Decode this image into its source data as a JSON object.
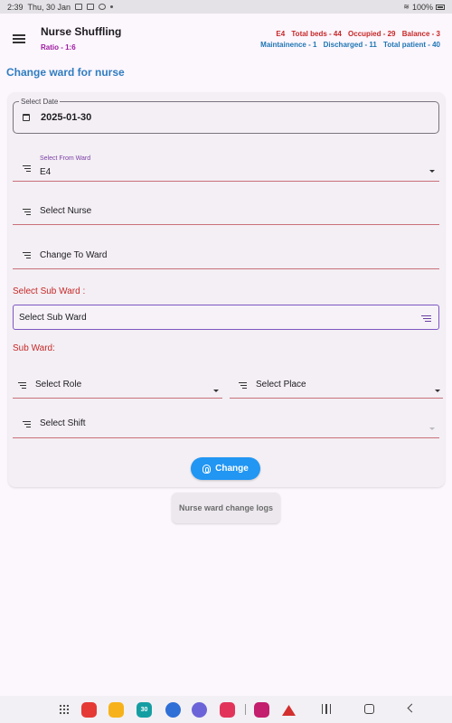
{
  "status_bar": {
    "time": "2:39",
    "date": "Thu, 30 Jan",
    "battery": "100%"
  },
  "header": {
    "title": "Nurse Shuffling",
    "ratio": "Ratio - 1:6",
    "stats_row1": [
      "E4",
      "Total beds - 44",
      "Occupied - 29",
      "Balance - 3"
    ],
    "stats_row2": [
      "Maintainence - 1",
      "Discharged - 11",
      "Total patient - 40"
    ],
    "colors": {
      "row1": "#c62828",
      "row2": "#1e76b4",
      "ratio": "#9c1aa0"
    }
  },
  "page": {
    "section_title": "Change ward for nurse"
  },
  "form": {
    "date_label": "Select Date",
    "date_value": "2025-01-30",
    "from_ward_label": "Select From Ward",
    "from_ward_value": "E4",
    "nurse_placeholder": "Select Nurse",
    "to_ward_placeholder": "Change To Ward",
    "sub_ward_heading": "Select Sub Ward :",
    "sub_ward_value": "Select Sub Ward",
    "sub_ward_label": "Sub Ward:",
    "role_placeholder": "Select Role",
    "place_placeholder": "Select Place",
    "shift_placeholder": "Select Shift",
    "change_button": "Change",
    "logs_button": "Nurse ward change logs"
  },
  "nav_bar": {
    "apps": [
      {
        "name": "app-icon-red",
        "color": "#e53935"
      },
      {
        "name": "app-icon-folder",
        "color": "#f7b21b"
      },
      {
        "name": "app-icon-calendar",
        "color": "#159ea2"
      },
      {
        "name": "app-icon-messages",
        "color": "#2f6fd6"
      },
      {
        "name": "app-icon-internet",
        "color": "#6d63d8"
      },
      {
        "name": "app-icon-camera",
        "color": "#e2345a"
      },
      {
        "name": "app-icon-flower",
        "color": "#c41e6e"
      },
      {
        "name": "app-icon-logo",
        "color": "#d32f2f"
      }
    ],
    "calendar_day": "30"
  }
}
